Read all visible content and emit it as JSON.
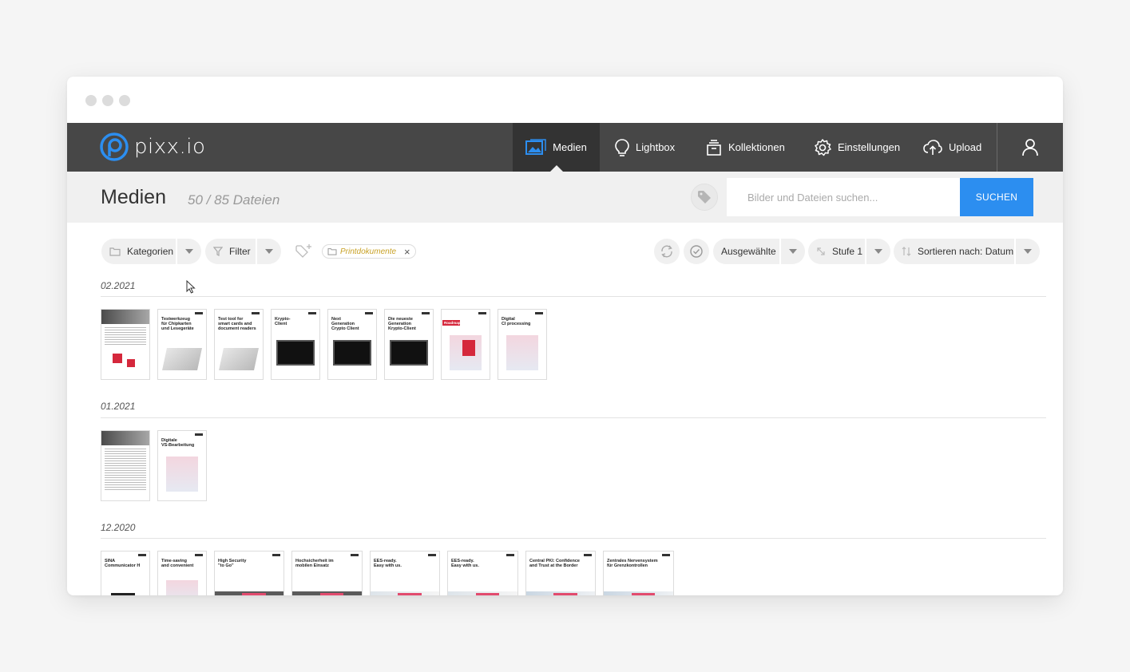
{
  "nav": {
    "logo_text": "pixx.io",
    "items": [
      {
        "label": "Medien",
        "icon": "image-icon"
      },
      {
        "label": "Lightbox",
        "icon": "lightbulb-icon"
      },
      {
        "label": "Kollektionen",
        "icon": "collections-icon"
      },
      {
        "label": "Einstellungen",
        "icon": "gear-icon"
      },
      {
        "label": "Upload",
        "icon": "cloud-upload-icon"
      }
    ]
  },
  "header": {
    "title": "Medien",
    "file_count": "50 / 85 Dateien",
    "search_placeholder": "Bilder und Dateien suchen...",
    "search_button": "SUCHEN"
  },
  "toolbar": {
    "kategorien": "Kategorien",
    "filter": "Filter",
    "chip_label": "Printdokumente",
    "chip_close": "×",
    "selected": "Ausgewählte",
    "level": "Stufe 1",
    "sort": "Sortieren nach: Datum"
  },
  "groups": [
    {
      "date": "02.2021",
      "thumbs": [
        {
          "title": ""
        },
        {
          "title": "Testwerkzeug\nfür Chipkarten\nund Lesegeräte"
        },
        {
          "title": "Test tool for\nsmart cards and\ndocument readers"
        },
        {
          "title": "Krypto-\nClient"
        },
        {
          "title": "Next\nGeneration\nCrypto Client"
        },
        {
          "title": "Die neueste\nGeneration\nKrypto-Client"
        },
        {
          "title": "Roadmap"
        },
        {
          "title": "Digital\nCI processing"
        }
      ]
    },
    {
      "date": "01.2021",
      "thumbs": [
        {
          "title": ""
        },
        {
          "title": "Digitale\nVS-Bearbeitung"
        }
      ]
    },
    {
      "date": "12.2020",
      "thumbs": [
        {
          "title": "SINA\nCommunicator H"
        },
        {
          "title": "Time-saving\nand convenient"
        },
        {
          "title": "High Security\n\"to Go\""
        },
        {
          "title": "Hochsicherheit im\nmobilen Einsatz"
        },
        {
          "title": "EES-ready.\nEasy with us."
        },
        {
          "title": "EES-ready.\nEasy with us."
        },
        {
          "title": "Central PKI: Confidence\nand Trust at the Border"
        },
        {
          "title": "Zentrales Nervensystem\nfür Grenzkontrollen"
        }
      ]
    }
  ],
  "colors": {
    "navbar": "#474747",
    "nav_active": "#333333",
    "accent": "#2c8ef0",
    "logo_blue": "#2c8ef0",
    "chip_text": "#c9a227",
    "brand_red": "#d5283c"
  }
}
